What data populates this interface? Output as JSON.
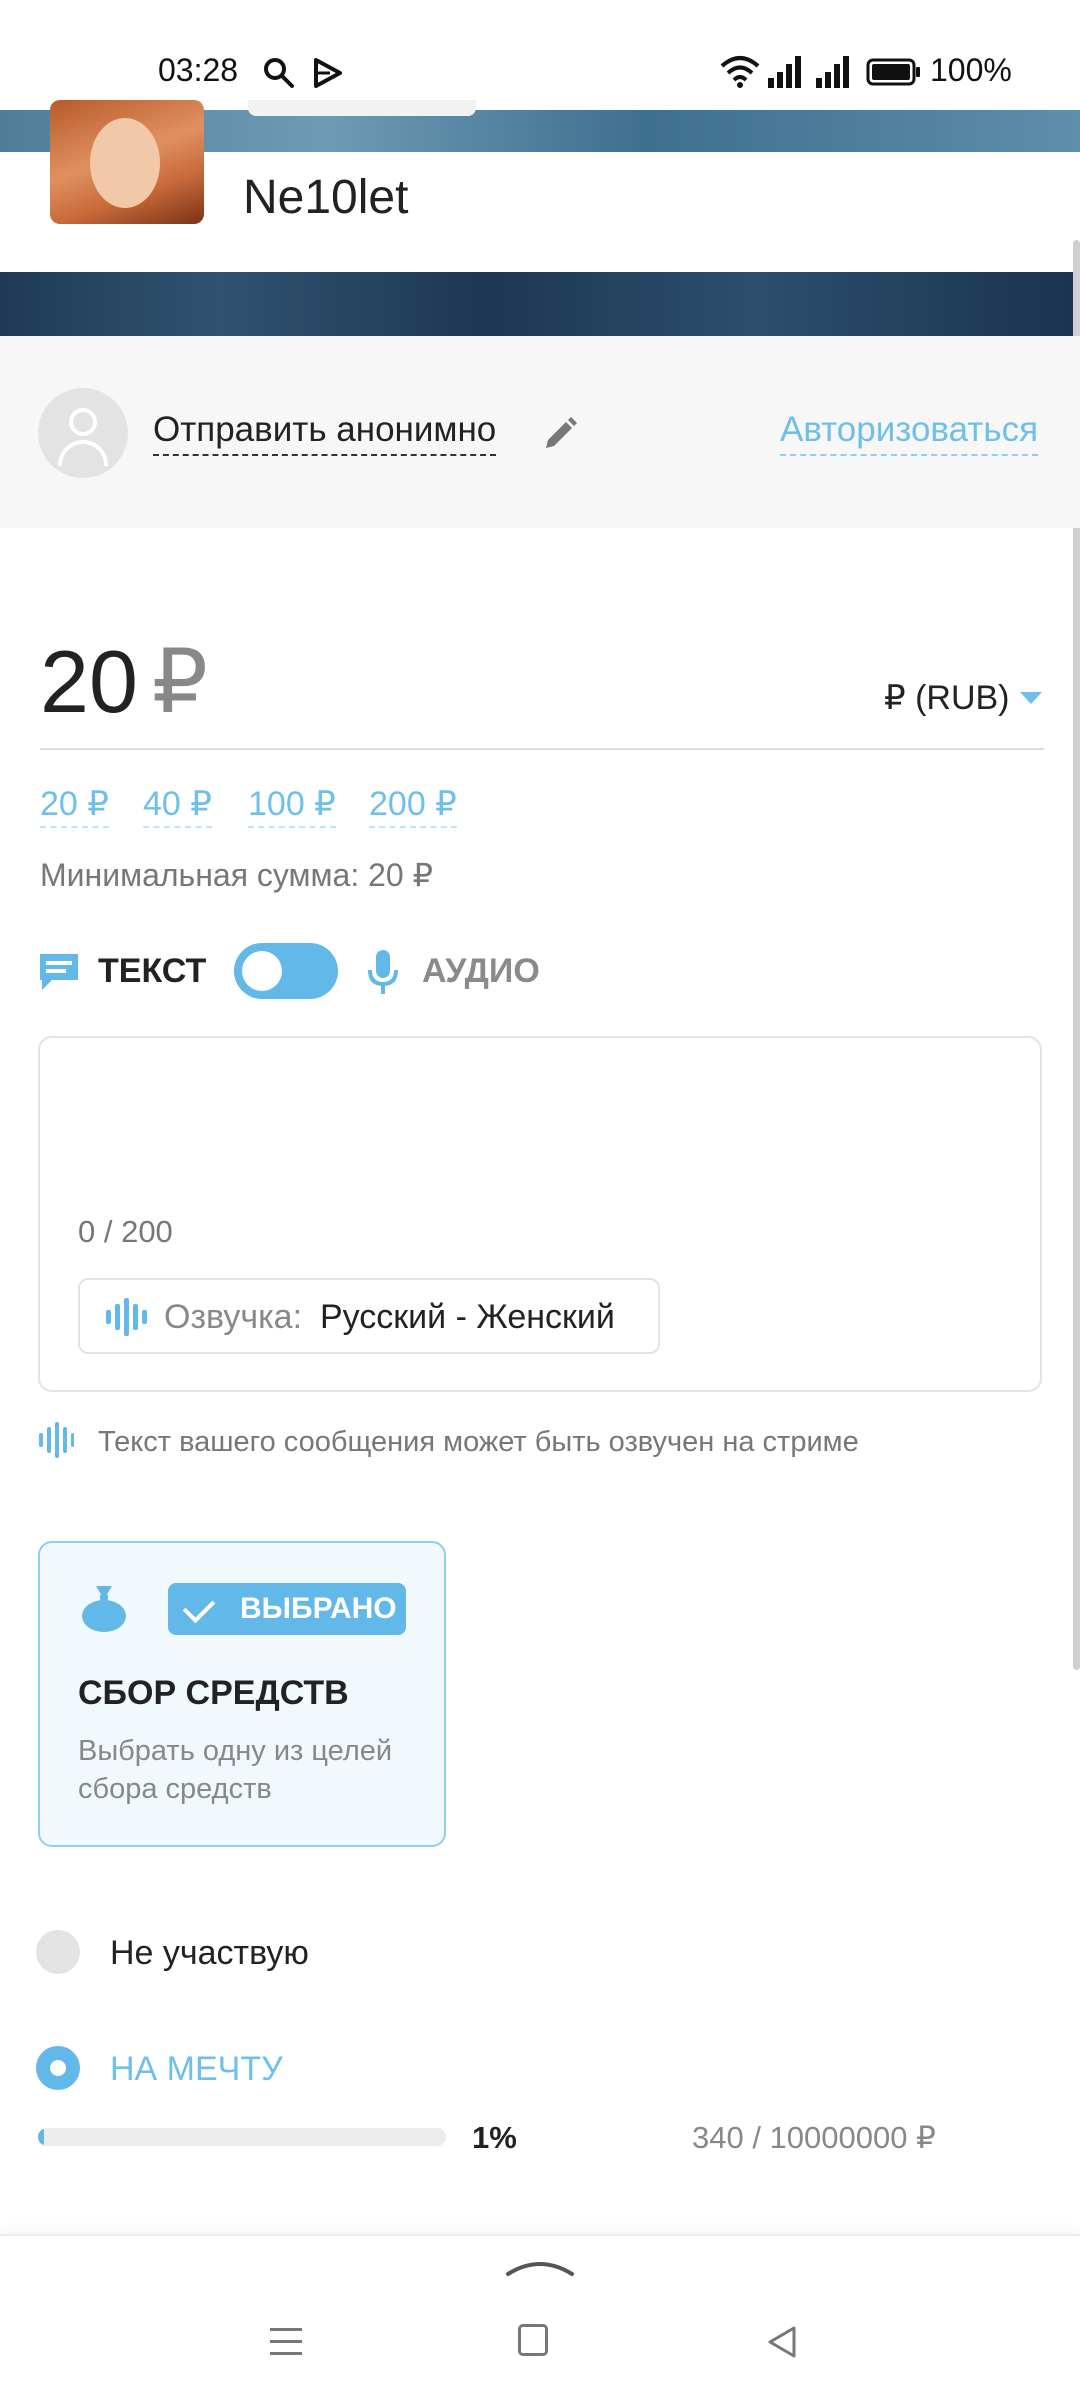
{
  "status_bar": {
    "time": "03:28",
    "battery_percent": "100%",
    "icons": [
      "search-icon",
      "play-icon",
      "wifi-icon",
      "signal-icon",
      "signal-icon",
      "battery-icon"
    ]
  },
  "header": {
    "username": "Ne10let"
  },
  "anon": {
    "label": "Отправить анонимно",
    "login": "Авторизоваться"
  },
  "donation": {
    "amount": "20",
    "currency_symbol": "₽",
    "currency_select": "₽ (RUB)",
    "presets": [
      "20 ₽",
      "40 ₽",
      "100 ₽",
      "200 ₽"
    ],
    "min_sum": "Минимальная сумма: 20 ₽"
  },
  "mode": {
    "text_label": "ТЕКСТ",
    "audio_label": "АУДИО"
  },
  "message": {
    "value": "",
    "counter": "0 / 200",
    "voice_label": "Озвучка:",
    "voice_value": "Русский - Женский",
    "hint": "Текст вашего сообщения может быть озвучен на стриме"
  },
  "fundraising": {
    "badge": "ВЫБРАНО",
    "title": "СБОР СРЕДСТВ",
    "description": "Выбрать одну из целей сбора средств"
  },
  "goals": {
    "none_label": "Не участвую",
    "dream_label": "НА МЕЧТУ",
    "dream_progress_fraction": 0.01,
    "dream_percent": "1%",
    "dream_amount": "340 / 10000000 ₽"
  },
  "colors": {
    "accent": "#62b8e8",
    "link": "#6ec0e8",
    "text": "#222222",
    "muted": "#888888"
  }
}
